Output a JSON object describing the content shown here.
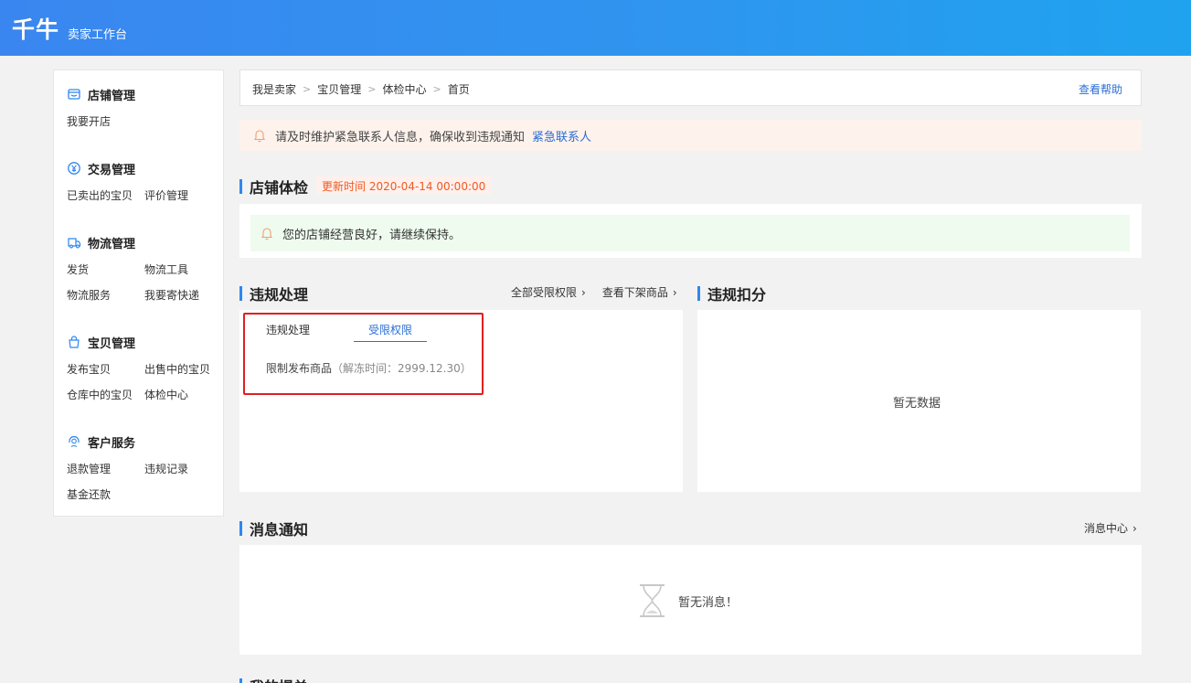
{
  "header": {
    "logo": "千牛",
    "subtitle": "卖家工作台"
  },
  "sidebar": {
    "sections": [
      {
        "title": "店铺管理",
        "icon": "store-icon",
        "links": [
          "我要开店"
        ]
      },
      {
        "title": "交易管理",
        "icon": "yen-icon",
        "links": [
          "已卖出的宝贝",
          "评价管理"
        ]
      },
      {
        "title": "物流管理",
        "icon": "truck-icon",
        "links": [
          "发货",
          "物流工具",
          "物流服务",
          "我要寄快递"
        ]
      },
      {
        "title": "宝贝管理",
        "icon": "bag-icon",
        "links": [
          "发布宝贝",
          "出售中的宝贝",
          "仓库中的宝贝",
          "体检中心"
        ]
      },
      {
        "title": "客户服务",
        "icon": "headset-icon",
        "links": [
          "退款管理",
          "违规记录",
          "基金还款"
        ]
      }
    ]
  },
  "breadcrumb": {
    "items": [
      "我是卖家",
      "宝贝管理",
      "体检中心",
      "首页"
    ],
    "help": "查看帮助"
  },
  "alert": {
    "text": "请及时维护紧急联系人信息，确保收到违规通知",
    "link": "紧急联系人"
  },
  "shop_check": {
    "title": "店铺体检",
    "update_label": "更新时间 2020-04-14 00:00:00",
    "status": "您的店铺经营良好，请继续保持。"
  },
  "violations": {
    "title": "违规处理",
    "link_all": "全部受限权限",
    "link_offshelf": "查看下架商品",
    "tabs": [
      "违规处理",
      "受限权限"
    ],
    "active_tab": "受限权限",
    "restriction": "限制发布商品",
    "restriction_note": "（解冻时间：2999.12.30）"
  },
  "deduction": {
    "title": "违规扣分",
    "empty": "暂无数据"
  },
  "messages": {
    "title": "消息通知",
    "link": "消息中心",
    "empty": "暂无消息！"
  },
  "bottom": {
    "title": "我的提单"
  },
  "colors": {
    "brand": "#2f86f0",
    "link": "#2a6ed8",
    "warning": "#ee5a24",
    "alert_bg": "#fdf2ec",
    "good_bg": "#eefbee",
    "highlight": "#e02020"
  }
}
